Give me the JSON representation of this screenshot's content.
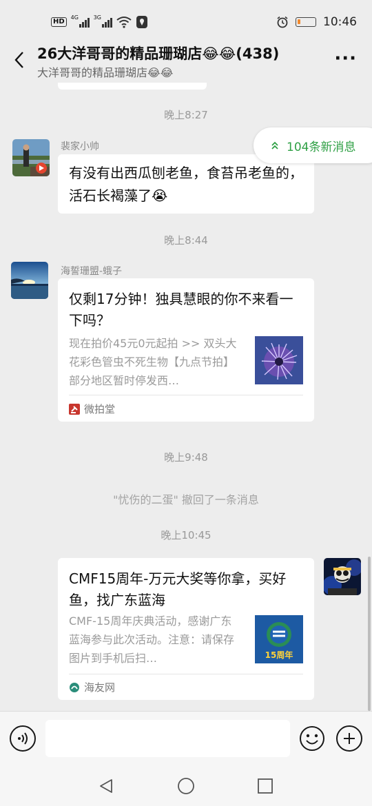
{
  "status_bar": {
    "network_hd": "HD",
    "network_1": "4G",
    "network_2": "3G",
    "time": "10:46",
    "battery_level": 0.2,
    "icons": [
      "hd-icon",
      "signal-icon",
      "wifi-icon",
      "location-icon",
      "alarm-icon",
      "battery-icon"
    ]
  },
  "header": {
    "title": "26大洋哥哥的精品珊瑚店😂😂(438)",
    "subtitle": "大洋哥哥的精品珊瑚店😂😂",
    "back_icon": "chevron-left-icon",
    "more_label": "···"
  },
  "new_messages": {
    "label": "104条新消息",
    "icon": "double-chevron-up-icon",
    "color": "#2fa045"
  },
  "chat": {
    "time_1": "晚上8:27",
    "message_1": {
      "sender": "裴家小帅",
      "text": "有没有出西瓜刨老鱼，食苔吊老鱼的，活石长褐藻了😭"
    },
    "time_2": "晚上8:44",
    "message_2": {
      "sender": "海誓珊盟-蛾子",
      "card_title": "仅剩17分钟！独具慧眼的你不来看一下吗？",
      "card_desc": "现在拍价45元0元起拍 >> 双头大花彩色管虫不死生物【九点节拍】部分地区暂时停发西…",
      "source": "微拍堂",
      "source_color": "#c8362e"
    },
    "time_3": "晚上9:48",
    "recall_text": "\"忧伤的二蛋\" 撤回了一条消息",
    "time_4": "晚上10:45",
    "message_3": {
      "card_title": "CMF15周年-万元大奖等你拿，买好鱼，找广东蓝海",
      "card_desc": "CMF-15周年庆典活动，感谢广东蓝海参与此次活动。注意：请保存图片到手机后扫…",
      "thumb_label": "15周年",
      "source": "海友网"
    }
  },
  "input_bar": {
    "placeholder": "",
    "value": "",
    "icons": [
      "voice-icon",
      "emoji-icon",
      "plus-icon"
    ]
  },
  "nav_bar": {
    "icons": [
      "nav-back-icon",
      "nav-home-icon",
      "nav-recents-icon"
    ]
  }
}
